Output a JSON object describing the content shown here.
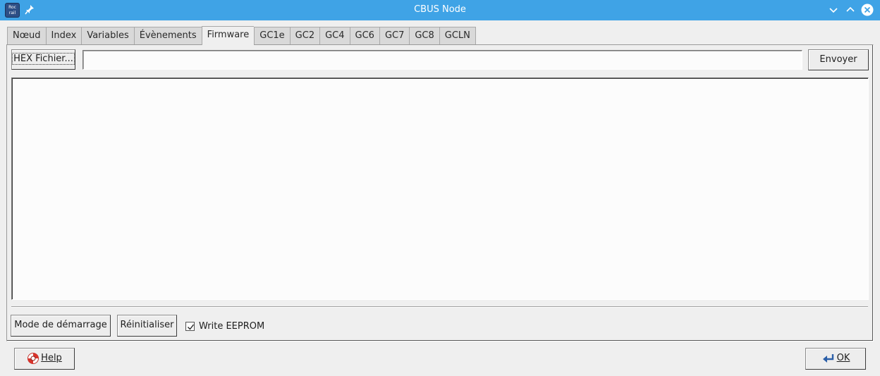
{
  "window": {
    "title": "CBUS Node",
    "app_icon_text": [
      "Roc",
      "rail"
    ]
  },
  "tabs": [
    {
      "label": "Nœud",
      "active": false
    },
    {
      "label": "Index",
      "active": false
    },
    {
      "label": "Variables",
      "active": false
    },
    {
      "label": "Évènements",
      "active": false
    },
    {
      "label": "Firmware",
      "active": true
    },
    {
      "label": "GC1e",
      "active": false
    },
    {
      "label": "GC2",
      "active": false
    },
    {
      "label": "GC4",
      "active": false
    },
    {
      "label": "GC6",
      "active": false
    },
    {
      "label": "GC7",
      "active": false
    },
    {
      "label": "GC8",
      "active": false
    },
    {
      "label": "GCLN",
      "active": false
    }
  ],
  "firmware": {
    "hex_button": "HEX Fichier...",
    "file_path_value": "",
    "send_button": "Envoyer",
    "log_text": "",
    "boot_mode_button": "Mode de démarrage",
    "reset_button": "Réinitialiser",
    "write_eeprom_label": "Write EEPROM",
    "write_eeprom_checked": true
  },
  "footer": {
    "help_button": "Help",
    "ok_button": "OK"
  },
  "colors": {
    "titlebar": "#3fa3e6",
    "window_bg": "#efefef"
  }
}
